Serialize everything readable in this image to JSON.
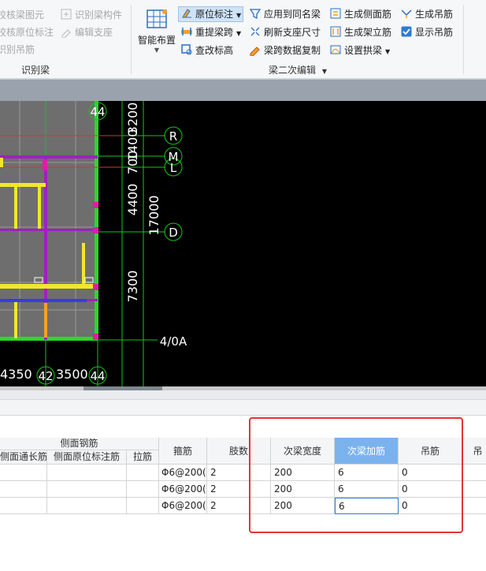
{
  "ribbon": {
    "left_items": [
      {
        "label": "校核梁图元",
        "enabled": false
      },
      {
        "label": "识别梁构件",
        "enabled": false
      },
      {
        "label": "校核原位标注",
        "enabled": false
      },
      {
        "label": "编辑支座",
        "enabled": false
      },
      {
        "label": "识别吊筋",
        "enabled": false
      }
    ],
    "group1_label": "识别梁",
    "smart_layout": "智能布置",
    "col_a": [
      {
        "label": "原位标注",
        "dropdown": true,
        "selected": true
      },
      {
        "label": "重提梁跨",
        "dropdown": true
      },
      {
        "label": "查改标高"
      }
    ],
    "col_b": [
      {
        "label": "应用到同名梁"
      },
      {
        "label": "刷新支座尺寸"
      },
      {
        "label": "梁跨数据复制"
      }
    ],
    "col_c": [
      {
        "label": "生成侧面筋"
      },
      {
        "label": "生成架立筋"
      },
      {
        "label": "设置拱梁",
        "dropdown": true
      }
    ],
    "col_d": [
      {
        "label": "生成吊筋"
      },
      {
        "label": "显示吊筋",
        "checked": true
      }
    ],
    "group2_label": "梁二次编辑"
  },
  "canvas": {
    "axis_labels": [
      "R",
      "M",
      "L",
      "D"
    ],
    "bottom_axis": [
      "42",
      "44"
    ],
    "top_axis": "44",
    "corner_label": "4/0A",
    "dims_vertical": [
      "3200",
      "1400",
      "700",
      "4400",
      "7300"
    ],
    "dim_total": "17000",
    "dims_horizontal": [
      "4350",
      "3500"
    ]
  },
  "table": {
    "group_header": "侧面钢筋",
    "subheaders": [
      "侧面通长筋",
      "侧面原位标注筋",
      "拉筋"
    ],
    "columns": [
      "箍筋",
      "肢数",
      "次梁宽度",
      "次梁加筋",
      "吊筋",
      "吊"
    ],
    "active_column": "次梁加筋",
    "rows": [
      {
        "stirrup": "Φ6@200(",
        "legs": "2",
        "width": "200",
        "add": "6",
        "hanger": "0"
      },
      {
        "stirrup": "Φ6@200(",
        "legs": "2",
        "width": "200",
        "add": "6",
        "hanger": "0"
      },
      {
        "stirrup": "Φ6@200(",
        "legs": "2",
        "width": "200",
        "add": "6",
        "hanger": "0"
      }
    ]
  }
}
